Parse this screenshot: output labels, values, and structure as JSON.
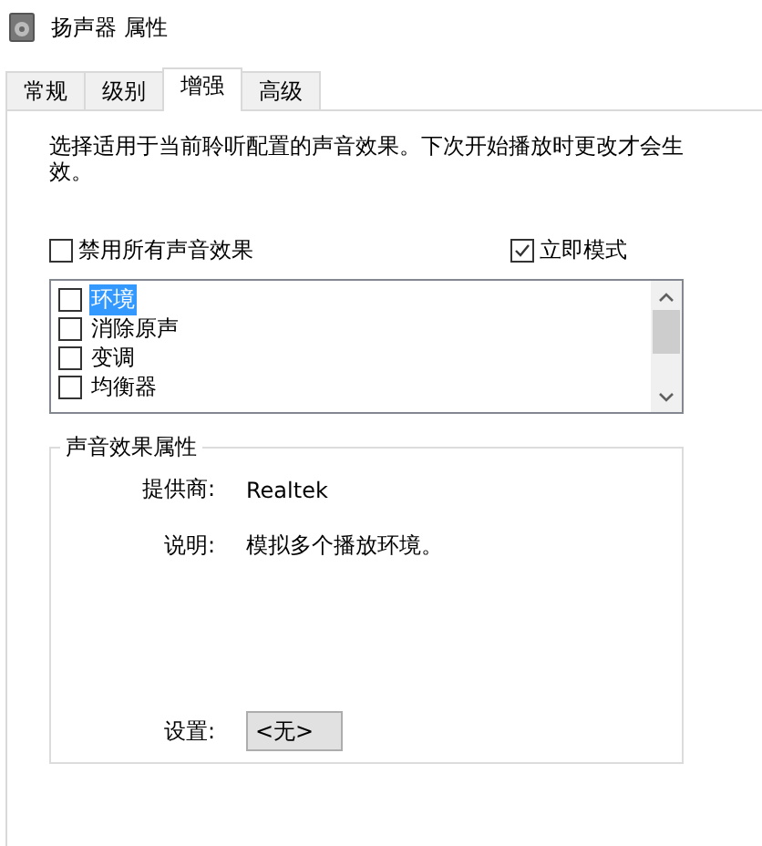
{
  "window": {
    "title": "扬声器 属性"
  },
  "tabs": [
    {
      "label": "常规",
      "selected": false
    },
    {
      "label": "级别",
      "selected": false
    },
    {
      "label": "增强",
      "selected": true
    },
    {
      "label": "高级",
      "selected": false
    }
  ],
  "description": "选择适用于当前聆听配置的声音效果。下次开始播放时更改才会生效。",
  "options": [
    {
      "label": "禁用所有声音效果",
      "checked": false
    },
    {
      "label": "立即模式",
      "checked": true
    }
  ],
  "effects": [
    {
      "label": "环境",
      "checked": false,
      "selected": true
    },
    {
      "label": "消除原声",
      "checked": false,
      "selected": false
    },
    {
      "label": "变调",
      "checked": false,
      "selected": false
    },
    {
      "label": "均衡器",
      "checked": false,
      "selected": false
    }
  ],
  "properties": {
    "title": "声音效果属性",
    "provider_label": "提供商:",
    "provider": "Realtek",
    "description_label": "说明:",
    "description": "模拟多个播放环境。",
    "settings_label": "设置:",
    "settings_value": "<无>"
  }
}
